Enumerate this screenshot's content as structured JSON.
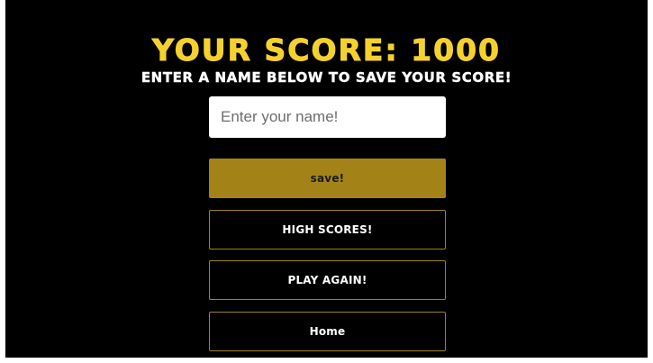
{
  "header": {
    "score_title": "YOUR SCORE: 1000",
    "subtitle": "ENTER A NAME BELOW TO SAVE YOUR SCORE!"
  },
  "form": {
    "name_placeholder": "Enter your name!",
    "name_value": ""
  },
  "buttons": {
    "save_label": "save!",
    "high_scores_label": "HIGH SCORES!",
    "play_again_label": "PLAY AGAIN!",
    "home_label": "Home"
  },
  "colors": {
    "accent": "#f5d12e",
    "button_gold": "#a38318",
    "background": "#000000"
  }
}
